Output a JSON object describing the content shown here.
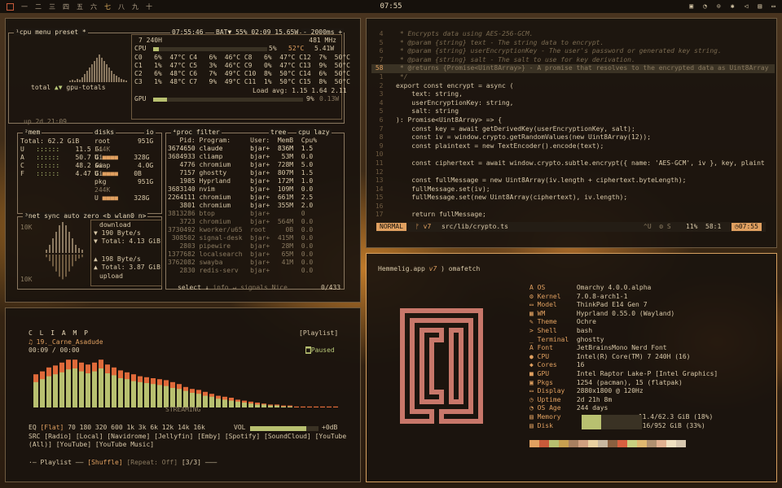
{
  "topbar": {
    "workspaces": [
      "一",
      "二",
      "三",
      "四",
      "五",
      "六",
      "七",
      "八",
      "九",
      "十"
    ],
    "active_ws": 6,
    "clock": "07:55"
  },
  "btop": {
    "cpu_label": "¹cpu",
    "menu_label": "menu",
    "preset_label": "preset *",
    "time": "07:55:46",
    "battery": "BAT▼ 55% 02:09 15.65W",
    "refresh": "- 2000ms +",
    "cpu_model": "7 240H",
    "mhz": "481 MHz",
    "total_cpu": {
      "name": "CPU",
      "pct": "5%",
      "temp": "52°C",
      "watt": "5.41W",
      "val": 0.05
    },
    "cores": [
      [
        "C0",
        "6%",
        "47°C",
        "C4",
        "6%",
        "46°C",
        "C8",
        "6%",
        "47°C",
        "C12",
        "7%",
        "50°C"
      ],
      [
        "C1",
        "1%",
        "47°C",
        "C5",
        "3%",
        "46°C",
        "C9",
        "0%",
        "47°C",
        "C13",
        "9%",
        "50°C"
      ],
      [
        "C2",
        "6%",
        "48°C",
        "C6",
        "7%",
        "49°C",
        "C10",
        "8%",
        "50°C",
        "C14",
        "6%",
        "50°C"
      ],
      [
        "C3",
        "1%",
        "48°C",
        "C7",
        "9%",
        "49°C",
        "C11",
        "1%",
        "50°C",
        "C15",
        "8%",
        "50°C"
      ]
    ],
    "load_avg": "Load avg: 1.15 1.64 2.11",
    "gpu_row": {
      "name": "GPU",
      "pct": "9%",
      "watt": "0.13W",
      "val": 0.09
    },
    "total_label": "total",
    "gpu_totals_label": "gpu-totals",
    "uptime": "up 2d 21:09",
    "mem_label": "²mem",
    "disks_label": "disks",
    "io_label": "io",
    "mem_total": "Total: 62.2 GiB",
    "mem_rows": [
      [
        "U",
        "11.5 Gi"
      ],
      [
        "A",
        "50.7 Gi"
      ],
      [
        "C",
        "48.2 Gi"
      ],
      [
        "F",
        "4.47 Gi"
      ]
    ],
    "disks": [
      {
        "name": "root",
        "size": "951G",
        "l1": "244K",
        "l2": "U",
        "l3": "328G"
      },
      {
        "name": "swap",
        "size": "4.0G",
        "l1": "",
        "l2": "U",
        "l3": "0B"
      },
      {
        "name": "pkg",
        "size": "951G",
        "l1": "244K",
        "l2": "U",
        "l3": "328G"
      }
    ],
    "net_label": "³net",
    "net_sync": "sync",
    "net_auto": "auto",
    "net_zero": "zero",
    "net_iface": "<b wlan0 n>",
    "net_10k_top": "10K",
    "net_10k_bot": "10K",
    "download_label": "download",
    "dl_rate": "▼ 190 Byte/s",
    "dl_total": "▼ Total: 4.13 GiB",
    "ul_rate": "▲ 198 Byte/s",
    "ul_total": "▲ Total: 3.87 GiB",
    "upload_label": "upload",
    "proc_label": "⁴proc",
    "filter_label": "filter",
    "tree_label": "tree",
    "cpu_lazy": "cpu lazy",
    "proc_header": [
      "Pid:",
      "Program:",
      "User:",
      "MemB",
      "Cpu%"
    ],
    "procs": [
      [
        "3674650",
        "claude",
        "bjar+",
        "836M",
        "1.5"
      ],
      [
        "3684933",
        "cliamp",
        "bjar+",
        "53M",
        "0.0"
      ],
      [
        "4776",
        "chromium",
        "bjar+",
        "728M",
        "5.0"
      ],
      [
        "7157",
        "ghostty",
        "bjar+",
        "807M",
        "1.5"
      ],
      [
        "1985",
        "Hyprland",
        "bjar+",
        "172M",
        "1.0"
      ],
      [
        "3683140",
        "nvim",
        "bjar+",
        "109M",
        "0.0"
      ],
      [
        "2264111",
        "chromium",
        "bjar+",
        "661M",
        "2.5"
      ],
      [
        "3801",
        "chromium",
        "bjar+",
        "355M",
        "2.0"
      ],
      [
        "3813286",
        "btop",
        "bjar+",
        "",
        "0"
      ],
      [
        "3723",
        "chromium",
        "bjar+",
        "564M",
        "0.0"
      ],
      [
        "3730492",
        "kworker/u65",
        "root",
        "0B",
        "0.0"
      ],
      [
        "308502",
        "signal-desk",
        "bjar+",
        "415M",
        "0.0"
      ],
      [
        "2803",
        "pipewire",
        "bjar+",
        "28M",
        "0.0"
      ],
      [
        "1377682",
        "localsearch",
        "bjar+",
        "65M",
        "0.0"
      ],
      [
        "3762082",
        "swayba",
        "bjar+",
        "41M",
        "0.0"
      ],
      [
        "2830",
        "redis-serv",
        "bjar+",
        "",
        "0.0"
      ]
    ],
    "proc_footer": [
      "select ↓",
      "info ↵",
      "signals",
      "Nice"
    ],
    "proc_count": "0/433"
  },
  "editor": {
    "lines": [
      {
        "n": "4",
        "t": " * Encrypts data using AES-256-GCM.",
        "c": "cm"
      },
      {
        "n": "5",
        "t": " * @param {string} text - The string data to encrypt.",
        "c": "cm"
      },
      {
        "n": "6",
        "t": " * @param {string} userEncryptionKey - The user's password or generated key string.",
        "c": "cm"
      },
      {
        "n": "7",
        "t": " * @param {string} salt - The salt to use for key derivation.",
        "c": "cm"
      },
      {
        "n": "58",
        "t": " * @returns {Promise<Uint8Array>} - A promise that resolves to the encrypted data as Uint8Array",
        "c": "cur"
      },
      {
        "n": "1",
        "t": " */",
        "c": "cm"
      },
      {
        "n": "2",
        "t": "export const encrypt = async (",
        "c": "cd"
      },
      {
        "n": "3",
        "t": "    text: string,",
        "c": "cd"
      },
      {
        "n": "4",
        "t": "    userEncryptionKey: string,",
        "c": "cd"
      },
      {
        "n": "5",
        "t": "    salt: string",
        "c": "cd"
      },
      {
        "n": "6",
        "t": "): Promise<Uint8Array> => {",
        "c": "cd"
      },
      {
        "n": "7",
        "t": "    const key = await getDerivedKey(userEncryptionKey, salt);",
        "c": "cd"
      },
      {
        "n": "8",
        "t": "    const iv = window.crypto.getRandomValues(new Uint8Array(12));",
        "c": "cd"
      },
      {
        "n": "9",
        "t": "    const plaintext = new TextEncoder().encode(text);",
        "c": "cd"
      },
      {
        "n": "10",
        "t": "",
        "c": "cd"
      },
      {
        "n": "11",
        "t": "    const ciphertext = await window.crypto.subtle.encrypt({ name: 'AES-GCM', iv }, key, plaint",
        "c": "cd"
      },
      {
        "n": "12",
        "t": "",
        "c": "cd"
      },
      {
        "n": "13",
        "t": "    const fullMessage = new Uint8Array(iv.length + ciphertext.byteLength);",
        "c": "cd"
      },
      {
        "n": "14",
        "t": "    fullMessage.set(iv);",
        "c": "cd"
      },
      {
        "n": "15",
        "t": "    fullMessage.set(new Uint8Array(ciphertext), iv.length);",
        "c": "cd"
      },
      {
        "n": "16",
        "t": "",
        "c": "cd"
      },
      {
        "n": "17",
        "t": "    return fullMessage;",
        "c": "cd"
      }
    ],
    "mode": "NORMAL",
    "branch": "v7",
    "file": "src/lib/crypto.ts",
    "status_right": "^U  ⚙ S",
    "percent": "11%",
    "pos": "58:1",
    "time": "07:55"
  },
  "player": {
    "title": "C L I A M P",
    "playlist_btn": "[Playlist]",
    "track": "♫ 19._Carne_Asadude",
    "time": "00:09 / 00:00",
    "paused": "Paused",
    "streaming": "STREAMING",
    "eq_label": "EQ",
    "eq_preset": "[Flat]",
    "eq_bands": "70 180 320 600 1k 3k 6k 12k 14k 16k",
    "vol_label": "VOL",
    "vol_db": "+0dB",
    "vol": 0.82,
    "src_label": "SRC",
    "sources_line1": "[Radio] [Local] [Navidrome] [Jellyfin] [Emby] [Spotify] [SoundCloud] [YouTube",
    "sources_line2": "(All)] [YouTube] [YouTube Music]",
    "footer_playlist": "·— Playlist ——",
    "footer_shuffle": "[Shuffle]",
    "footer_repeat": "[Repeat: Off]",
    "footer_count": "[3/3]",
    "spectrum_outer": [
      0.34,
      0.37,
      0.41,
      0.43,
      0.46,
      0.49,
      0.49,
      0.46,
      0.44,
      0.46,
      0.49,
      0.44,
      0.41,
      0.38,
      0.36,
      0.34,
      0.32,
      0.31,
      0.3,
      0.29,
      0.28,
      0.26,
      0.24,
      0.21,
      0.19,
      0.18,
      0.16,
      0.14,
      0.12,
      0.11,
      0.1,
      0.08,
      0.07,
      0.06,
      0.05,
      0.04,
      0.03,
      0.03,
      0.02,
      0.02,
      0.01,
      0.01,
      0.01,
      0.01,
      0.01,
      0.01,
      0.01
    ],
    "spectrum_inner": [
      0.26,
      0.29,
      0.32,
      0.34,
      0.36,
      0.39,
      0.4,
      0.37,
      0.35,
      0.37,
      0.4,
      0.35,
      0.33,
      0.3,
      0.29,
      0.27,
      0.26,
      0.25,
      0.24,
      0.23,
      0.22,
      0.2,
      0.19,
      0.17,
      0.15,
      0.14,
      0.12,
      0.11,
      0.09,
      0.08,
      0.07,
      0.06,
      0.05,
      0.04,
      0.03,
      0.03,
      0.02,
      0.02,
      0.01,
      0.01,
      0.0,
      0.0,
      0.0,
      0.0,
      0.0,
      0.0,
      0.0
    ]
  },
  "fetch": {
    "prompt_host": "Hemmelig.app",
    "prompt_branch": "v7",
    "prompt_cmd": ") omafetch",
    "rows": [
      {
        "icon": "A",
        "k": "OS",
        "v": "Omarchy 4.0.0.alpha"
      },
      {
        "icon": "⚙",
        "k": "Kernel",
        "v": "7.0.8-arch1-1"
      },
      {
        "icon": "▭",
        "k": "Model",
        "v": "ThinkPad E14 Gen 7"
      },
      {
        "icon": "▦",
        "k": "WM",
        "v": "Hyprland 0.55.0 (Wayland)"
      },
      {
        "icon": "✎",
        "k": "Theme",
        "v": "Ochre"
      },
      {
        "icon": ">",
        "k": "Shell",
        "v": "bash"
      },
      {
        "icon": "_",
        "k": "Terminal",
        "v": "ghostty"
      },
      {
        "icon": "A",
        "k": "Font",
        "v": "JetBrainsMono Nerd Font"
      },
      {
        "icon": "●",
        "k": "CPU",
        "v": "Intel(R) Core(TM) 7 240H (16)"
      },
      {
        "icon": "◆",
        "k": "Cores",
        "v": "16"
      },
      {
        "icon": "■",
        "k": "GPU",
        "v": "Intel Raptor Lake-P [Intel Graphics]"
      },
      {
        "icon": "▣",
        "k": "Pkgs",
        "v": "1254 (pacman), 15 (flatpak)"
      },
      {
        "icon": "▭",
        "k": "Display",
        "v": "2880x1800 @ 120Hz"
      },
      {
        "icon": "◷",
        "k": "Uptime",
        "v": "2d 21h 8m"
      },
      {
        "icon": "◔",
        "k": "OS Age",
        "v": "244 days"
      },
      {
        "icon": "▤",
        "k": "Memory",
        "v": "11.4/62.3 GiB (18%)"
      },
      {
        "icon": "▤",
        "k": "Disk",
        "v": "316/952 GiB (33%)"
      }
    ],
    "mem_frac": 0.18,
    "disk_frac": 0.33,
    "palette": [
      "#e0a060",
      "#c85a3a",
      "#b8c070",
      "#c8a050",
      "#a88060",
      "#d0a080",
      "#e8d0a0",
      "#c8b8a0",
      "#8a6040",
      "#d86040",
      "#c8d080",
      "#e0b870",
      "#b09070",
      "#e0b090",
      "#f0e0c0",
      "#d8c8b0"
    ]
  }
}
